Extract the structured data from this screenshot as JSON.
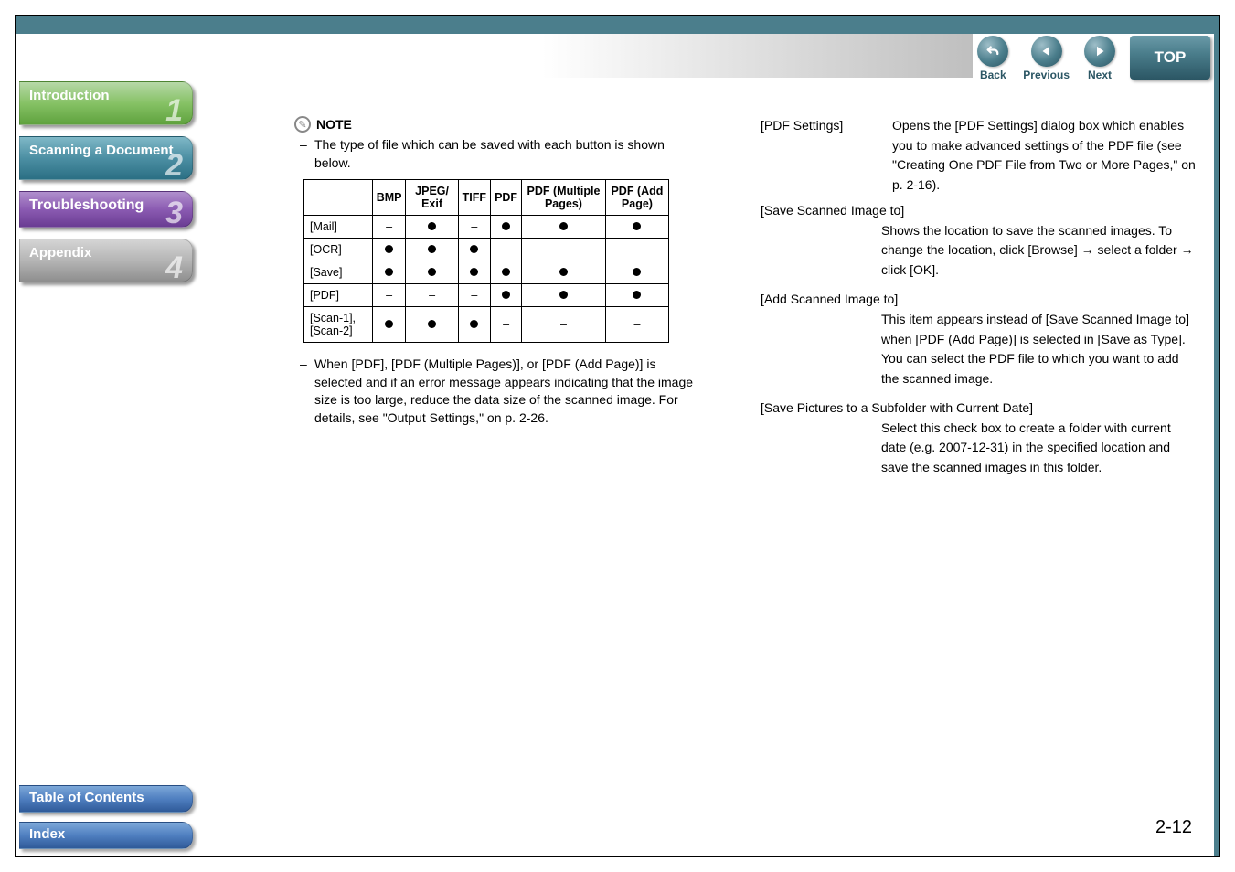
{
  "nav": {
    "back": "Back",
    "previous": "Previous",
    "next": "Next",
    "top": "TOP"
  },
  "sidebar": {
    "introduction": {
      "label": "Introduction",
      "num": "1"
    },
    "scanning": {
      "label": "Scanning a Document",
      "num": "2"
    },
    "troubleshoot": {
      "label": "Troubleshooting",
      "num": "3"
    },
    "appendix": {
      "label": "Appendix",
      "num": "4"
    }
  },
  "bottom": {
    "toc": "Table of Contents",
    "index": "Index"
  },
  "note": {
    "title": "NOTE",
    "intro": "The type of file which can be saved with each button is shown below.",
    "post": "When [PDF], [PDF (Multiple Pages)], or [PDF (Add Page)] is selected and if an error message appears indicating that the image size is too large, reduce the data size of the scanned image. For details, see \"Output Settings,\" on p. 2-26."
  },
  "table": {
    "headers": {
      "bmp": "BMP",
      "jpeg": "JPEG/ Exif",
      "tiff": "TIFF",
      "pdf": "PDF",
      "pdfm": "PDF (Multiple Pages)",
      "pdfa": "PDF (Add Page)"
    },
    "rows": {
      "mail": "[Mail]",
      "ocr": "[OCR]",
      "save": "[Save]",
      "pdf": "[PDF]",
      "scan": "[Scan-1], [Scan-2]"
    }
  },
  "chart_data": {
    "type": "table",
    "columns": [
      "BMP",
      "JPEG/Exif",
      "TIFF",
      "PDF",
      "PDF (Multiple Pages)",
      "PDF (Add Page)"
    ],
    "rows": [
      {
        "name": "[Mail]",
        "values": [
          false,
          true,
          false,
          true,
          true,
          true
        ]
      },
      {
        "name": "[OCR]",
        "values": [
          true,
          true,
          true,
          false,
          false,
          false
        ]
      },
      {
        "name": "[Save]",
        "values": [
          true,
          true,
          true,
          true,
          true,
          true
        ]
      },
      {
        "name": "[PDF]",
        "values": [
          false,
          false,
          false,
          true,
          true,
          true
        ]
      },
      {
        "name": "[Scan-1], [Scan-2]",
        "values": [
          true,
          true,
          true,
          false,
          false,
          false
        ]
      }
    ]
  },
  "defs": {
    "pdf_settings": {
      "term": "[PDF Settings]",
      "body": "Opens the [PDF Settings] dialog box which enables you to make advanced settings of the PDF file (see \"Creating One PDF File from Two or More Pages,\" on p. 2-16)."
    },
    "save_to": {
      "term": "[Save Scanned Image to]",
      "body": "Shows the location to save the scanned images. To change the location, click [Browse] → select a folder → click [OK]."
    },
    "add_to": {
      "term": "[Add Scanned Image to]",
      "body": "This item appears instead of [Save Scanned Image to] when [PDF (Add Page)] is selected in [Save as Type]. You can select the PDF file to which you want to add the scanned image."
    },
    "subfolder": {
      "term": "[Save Pictures to a Subfolder with Current Date]",
      "body": "Select this check box to create a folder with current date (e.g. 2007-12-31) in the specified location and save the scanned images in this folder."
    }
  },
  "page_number": "2-12"
}
